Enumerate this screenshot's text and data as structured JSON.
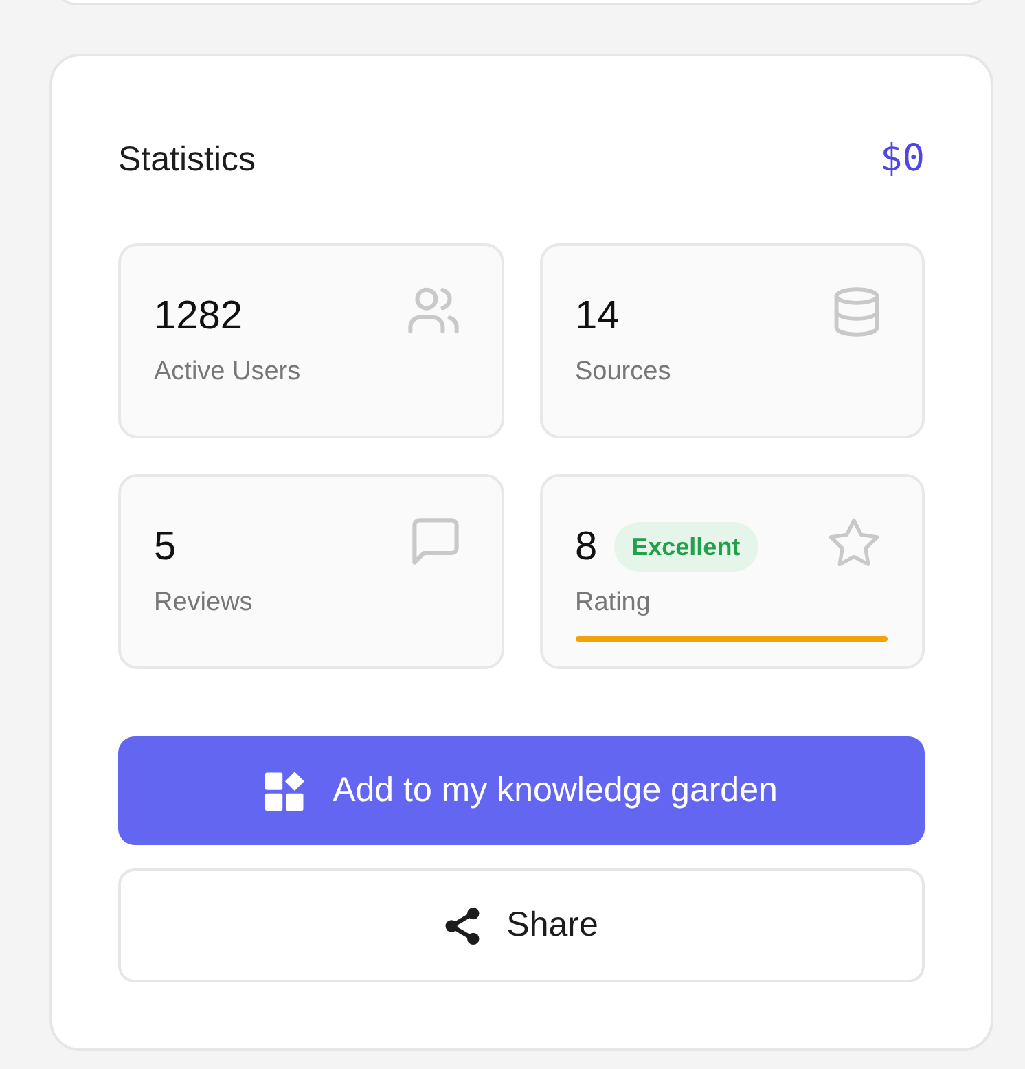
{
  "header": {
    "title": "Statistics",
    "total": "$0"
  },
  "stats": [
    {
      "kind": "metric",
      "value": "1282",
      "label": "Active Users"
    },
    {
      "kind": "metric",
      "value": "14",
      "label": "Sources"
    },
    {
      "kind": "metric",
      "value": "5",
      "label": "Reviews"
    },
    {
      "kind": "rating",
      "value": "8",
      "badge": "Excellent",
      "label": "Rating"
    }
  ],
  "actions": [
    {
      "kind": "primary",
      "label": "Add to my knowledge garden"
    },
    {
      "kind": "secondary",
      "label": "Share"
    }
  ]
}
